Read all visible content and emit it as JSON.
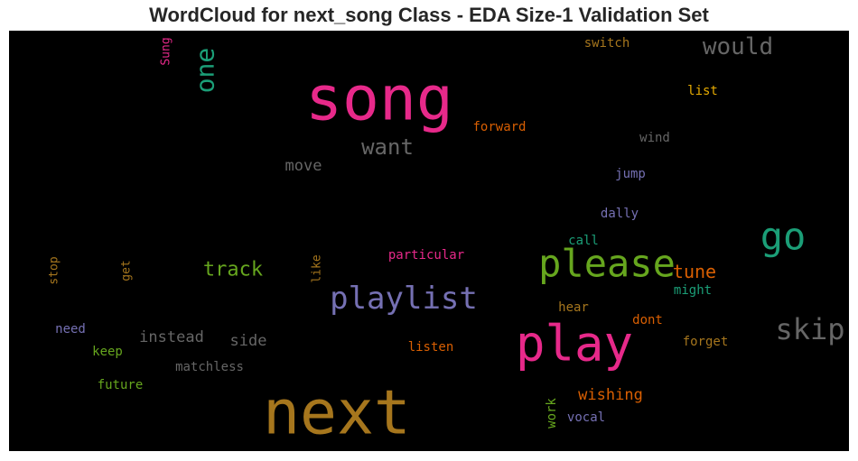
{
  "chart_data": {
    "type": "wordcloud",
    "title": "WordCloud for next_song Class - EDA Size-1 Validation Set",
    "background": "#000000",
    "palette": [
      "#1b9e77",
      "#d95f02",
      "#7570b3",
      "#e7298a",
      "#66a61e",
      "#e6ab02",
      "#a6761d",
      "#666666"
    ],
    "words": [
      {
        "text": "song",
        "color": "#e7298a",
        "rotated": false
      },
      {
        "text": "next",
        "color": "#a6761d",
        "rotated": false
      },
      {
        "text": "play",
        "color": "#e7298a",
        "rotated": false
      },
      {
        "text": "please",
        "color": "#66a61e",
        "rotated": false
      },
      {
        "text": "playlist",
        "color": "#7570b3",
        "rotated": false
      },
      {
        "text": "go",
        "color": "#1b9e77",
        "rotated": false
      },
      {
        "text": "skip",
        "color": "#666666",
        "rotated": false
      },
      {
        "text": "would",
        "color": "#666666",
        "rotated": false
      },
      {
        "text": "one",
        "color": "#1b9e77",
        "rotated": true
      },
      {
        "text": "want",
        "color": "#666666",
        "rotated": false
      },
      {
        "text": "track",
        "color": "#66a61e",
        "rotated": false
      },
      {
        "text": "tune",
        "color": "#d95f02",
        "rotated": false
      },
      {
        "text": "wishing",
        "color": "#d95f02",
        "rotated": false
      },
      {
        "text": "move",
        "color": "#666666",
        "rotated": false
      },
      {
        "text": "instead",
        "color": "#666666",
        "rotated": false
      },
      {
        "text": "side",
        "color": "#666666",
        "rotated": false
      },
      {
        "text": "forward",
        "color": "#d95f02",
        "rotated": false
      },
      {
        "text": "switch",
        "color": "#a6761d",
        "rotated": false
      },
      {
        "text": "list",
        "color": "#e6ab02",
        "rotated": false
      },
      {
        "text": "wind",
        "color": "#666666",
        "rotated": false
      },
      {
        "text": "jump",
        "color": "#7570b3",
        "rotated": false
      },
      {
        "text": "dally",
        "color": "#7570b3",
        "rotated": false
      },
      {
        "text": "call",
        "color": "#1b9e77",
        "rotated": false
      },
      {
        "text": "might",
        "color": "#1b9e77",
        "rotated": false
      },
      {
        "text": "particular",
        "color": "#e7298a",
        "rotated": false
      },
      {
        "text": "hear",
        "color": "#a6761d",
        "rotated": false
      },
      {
        "text": "dont",
        "color": "#d95f02",
        "rotated": false
      },
      {
        "text": "forget",
        "color": "#a6761d",
        "rotated": false
      },
      {
        "text": "listen",
        "color": "#d95f02",
        "rotated": false
      },
      {
        "text": "vocal",
        "color": "#7570b3",
        "rotated": false
      },
      {
        "text": "work",
        "color": "#66a61e",
        "rotated": true
      },
      {
        "text": "need",
        "color": "#7570b3",
        "rotated": false
      },
      {
        "text": "keep",
        "color": "#66a61e",
        "rotated": false
      },
      {
        "text": "matchless",
        "color": "#666666",
        "rotated": false
      },
      {
        "text": "future",
        "color": "#66a61e",
        "rotated": false
      },
      {
        "text": "Sung",
        "color": "#e7298a",
        "rotated": true
      },
      {
        "text": "stop",
        "color": "#a6761d",
        "rotated": true
      },
      {
        "text": "get",
        "color": "#a6761d",
        "rotated": true
      },
      {
        "text": "like",
        "color": "#a6761d",
        "rotated": true
      }
    ]
  }
}
